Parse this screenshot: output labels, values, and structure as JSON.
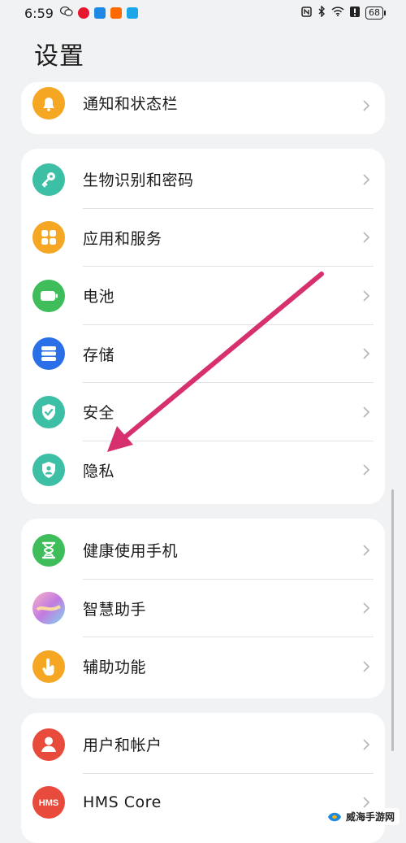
{
  "status_bar": {
    "time": "6:59",
    "battery": "68"
  },
  "page": {
    "title": "设置"
  },
  "groups": [
    {
      "items": [
        {
          "label": "通知和状态栏",
          "icon": "bell-icon",
          "color": "#f5a623"
        }
      ]
    },
    {
      "items": [
        {
          "label": "生物识别和密码",
          "icon": "key-icon",
          "color": "#3dbfa5"
        },
        {
          "label": "应用和服务",
          "icon": "apps-grid-icon",
          "color": "#f5a623"
        },
        {
          "label": "电池",
          "icon": "battery-icon",
          "color": "#3ebd5a"
        },
        {
          "label": "存储",
          "icon": "storage-icon",
          "color": "#2a6fe8"
        },
        {
          "label": "安全",
          "icon": "shield-check-icon",
          "color": "#3dbfa5"
        },
        {
          "label": "隐私",
          "icon": "privacy-shield-icon",
          "color": "#3dbfa5"
        }
      ]
    },
    {
      "items": [
        {
          "label": "健康使用手机",
          "icon": "hourglass-icon",
          "color": "#3ebd5a"
        },
        {
          "label": "智慧助手",
          "icon": "assistant-orb-icon",
          "color": "#b57ad8"
        },
        {
          "label": "辅助功能",
          "icon": "hand-icon",
          "color": "#f5a623"
        }
      ]
    },
    {
      "items": [
        {
          "label": "用户和帐户",
          "icon": "user-icon",
          "color": "#e84a3c"
        },
        {
          "label": "HMS Core",
          "icon": "hms-icon",
          "color": "#e84a3c"
        }
      ]
    }
  ],
  "annotation": {
    "color": "#d6306e"
  },
  "watermark": {
    "text": "威海手游网"
  }
}
